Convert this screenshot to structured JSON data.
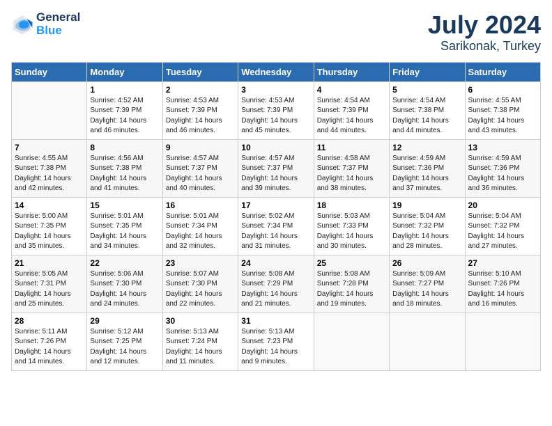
{
  "header": {
    "logo_line1": "General",
    "logo_line2": "Blue",
    "title": "July 2024",
    "subtitle": "Sarikonak, Turkey"
  },
  "weekdays": [
    "Sunday",
    "Monday",
    "Tuesday",
    "Wednesday",
    "Thursday",
    "Friday",
    "Saturday"
  ],
  "weeks": [
    [
      {
        "day": "",
        "sunrise": "",
        "sunset": "",
        "daylight": ""
      },
      {
        "day": "1",
        "sunrise": "Sunrise: 4:52 AM",
        "sunset": "Sunset: 7:39 PM",
        "daylight": "Daylight: 14 hours and 46 minutes."
      },
      {
        "day": "2",
        "sunrise": "Sunrise: 4:53 AM",
        "sunset": "Sunset: 7:39 PM",
        "daylight": "Daylight: 14 hours and 46 minutes."
      },
      {
        "day": "3",
        "sunrise": "Sunrise: 4:53 AM",
        "sunset": "Sunset: 7:39 PM",
        "daylight": "Daylight: 14 hours and 45 minutes."
      },
      {
        "day": "4",
        "sunrise": "Sunrise: 4:54 AM",
        "sunset": "Sunset: 7:39 PM",
        "daylight": "Daylight: 14 hours and 44 minutes."
      },
      {
        "day": "5",
        "sunrise": "Sunrise: 4:54 AM",
        "sunset": "Sunset: 7:38 PM",
        "daylight": "Daylight: 14 hours and 44 minutes."
      },
      {
        "day": "6",
        "sunrise": "Sunrise: 4:55 AM",
        "sunset": "Sunset: 7:38 PM",
        "daylight": "Daylight: 14 hours and 43 minutes."
      }
    ],
    [
      {
        "day": "7",
        "sunrise": "Sunrise: 4:55 AM",
        "sunset": "Sunset: 7:38 PM",
        "daylight": "Daylight: 14 hours and 42 minutes."
      },
      {
        "day": "8",
        "sunrise": "Sunrise: 4:56 AM",
        "sunset": "Sunset: 7:38 PM",
        "daylight": "Daylight: 14 hours and 41 minutes."
      },
      {
        "day": "9",
        "sunrise": "Sunrise: 4:57 AM",
        "sunset": "Sunset: 7:37 PM",
        "daylight": "Daylight: 14 hours and 40 minutes."
      },
      {
        "day": "10",
        "sunrise": "Sunrise: 4:57 AM",
        "sunset": "Sunset: 7:37 PM",
        "daylight": "Daylight: 14 hours and 39 minutes."
      },
      {
        "day": "11",
        "sunrise": "Sunrise: 4:58 AM",
        "sunset": "Sunset: 7:37 PM",
        "daylight": "Daylight: 14 hours and 38 minutes."
      },
      {
        "day": "12",
        "sunrise": "Sunrise: 4:59 AM",
        "sunset": "Sunset: 7:36 PM",
        "daylight": "Daylight: 14 hours and 37 minutes."
      },
      {
        "day": "13",
        "sunrise": "Sunrise: 4:59 AM",
        "sunset": "Sunset: 7:36 PM",
        "daylight": "Daylight: 14 hours and 36 minutes."
      }
    ],
    [
      {
        "day": "14",
        "sunrise": "Sunrise: 5:00 AM",
        "sunset": "Sunset: 7:35 PM",
        "daylight": "Daylight: 14 hours and 35 minutes."
      },
      {
        "day": "15",
        "sunrise": "Sunrise: 5:01 AM",
        "sunset": "Sunset: 7:35 PM",
        "daylight": "Daylight: 14 hours and 34 minutes."
      },
      {
        "day": "16",
        "sunrise": "Sunrise: 5:01 AM",
        "sunset": "Sunset: 7:34 PM",
        "daylight": "Daylight: 14 hours and 32 minutes."
      },
      {
        "day": "17",
        "sunrise": "Sunrise: 5:02 AM",
        "sunset": "Sunset: 7:34 PM",
        "daylight": "Daylight: 14 hours and 31 minutes."
      },
      {
        "day": "18",
        "sunrise": "Sunrise: 5:03 AM",
        "sunset": "Sunset: 7:33 PM",
        "daylight": "Daylight: 14 hours and 30 minutes."
      },
      {
        "day": "19",
        "sunrise": "Sunrise: 5:04 AM",
        "sunset": "Sunset: 7:32 PM",
        "daylight": "Daylight: 14 hours and 28 minutes."
      },
      {
        "day": "20",
        "sunrise": "Sunrise: 5:04 AM",
        "sunset": "Sunset: 7:32 PM",
        "daylight": "Daylight: 14 hours and 27 minutes."
      }
    ],
    [
      {
        "day": "21",
        "sunrise": "Sunrise: 5:05 AM",
        "sunset": "Sunset: 7:31 PM",
        "daylight": "Daylight: 14 hours and 25 minutes."
      },
      {
        "day": "22",
        "sunrise": "Sunrise: 5:06 AM",
        "sunset": "Sunset: 7:30 PM",
        "daylight": "Daylight: 14 hours and 24 minutes."
      },
      {
        "day": "23",
        "sunrise": "Sunrise: 5:07 AM",
        "sunset": "Sunset: 7:30 PM",
        "daylight": "Daylight: 14 hours and 22 minutes."
      },
      {
        "day": "24",
        "sunrise": "Sunrise: 5:08 AM",
        "sunset": "Sunset: 7:29 PM",
        "daylight": "Daylight: 14 hours and 21 minutes."
      },
      {
        "day": "25",
        "sunrise": "Sunrise: 5:08 AM",
        "sunset": "Sunset: 7:28 PM",
        "daylight": "Daylight: 14 hours and 19 minutes."
      },
      {
        "day": "26",
        "sunrise": "Sunrise: 5:09 AM",
        "sunset": "Sunset: 7:27 PM",
        "daylight": "Daylight: 14 hours and 18 minutes."
      },
      {
        "day": "27",
        "sunrise": "Sunrise: 5:10 AM",
        "sunset": "Sunset: 7:26 PM",
        "daylight": "Daylight: 14 hours and 16 minutes."
      }
    ],
    [
      {
        "day": "28",
        "sunrise": "Sunrise: 5:11 AM",
        "sunset": "Sunset: 7:26 PM",
        "daylight": "Daylight: 14 hours and 14 minutes."
      },
      {
        "day": "29",
        "sunrise": "Sunrise: 5:12 AM",
        "sunset": "Sunset: 7:25 PM",
        "daylight": "Daylight: 14 hours and 12 minutes."
      },
      {
        "day": "30",
        "sunrise": "Sunrise: 5:13 AM",
        "sunset": "Sunset: 7:24 PM",
        "daylight": "Daylight: 14 hours and 11 minutes."
      },
      {
        "day": "31",
        "sunrise": "Sunrise: 5:13 AM",
        "sunset": "Sunset: 7:23 PM",
        "daylight": "Daylight: 14 hours and 9 minutes."
      },
      {
        "day": "",
        "sunrise": "",
        "sunset": "",
        "daylight": ""
      },
      {
        "day": "",
        "sunrise": "",
        "sunset": "",
        "daylight": ""
      },
      {
        "day": "",
        "sunrise": "",
        "sunset": "",
        "daylight": ""
      }
    ]
  ]
}
